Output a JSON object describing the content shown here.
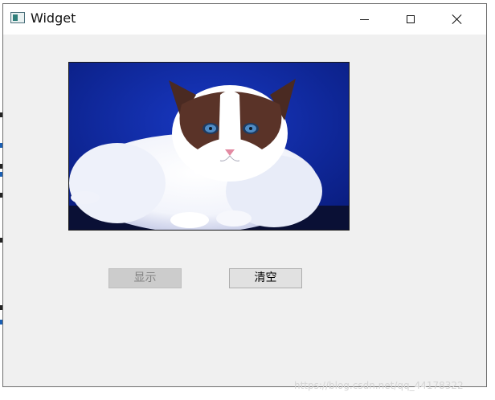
{
  "window": {
    "title": "Widget",
    "controls": {
      "minimize": "minimize-icon",
      "maximize": "maximize-icon",
      "close": "close-icon"
    }
  },
  "main": {
    "image_icon": "cat-photo",
    "buttons": {
      "show_label": "显示",
      "clear_label": "清空"
    }
  },
  "watermark": "https://blog.csdn.net/qq_44178322",
  "colors": {
    "window_bg": "#f0f0f0",
    "image_bg": "#0b1f86",
    "disabled_button_bg": "#cccccc",
    "button_bg": "#e1e1e1"
  }
}
